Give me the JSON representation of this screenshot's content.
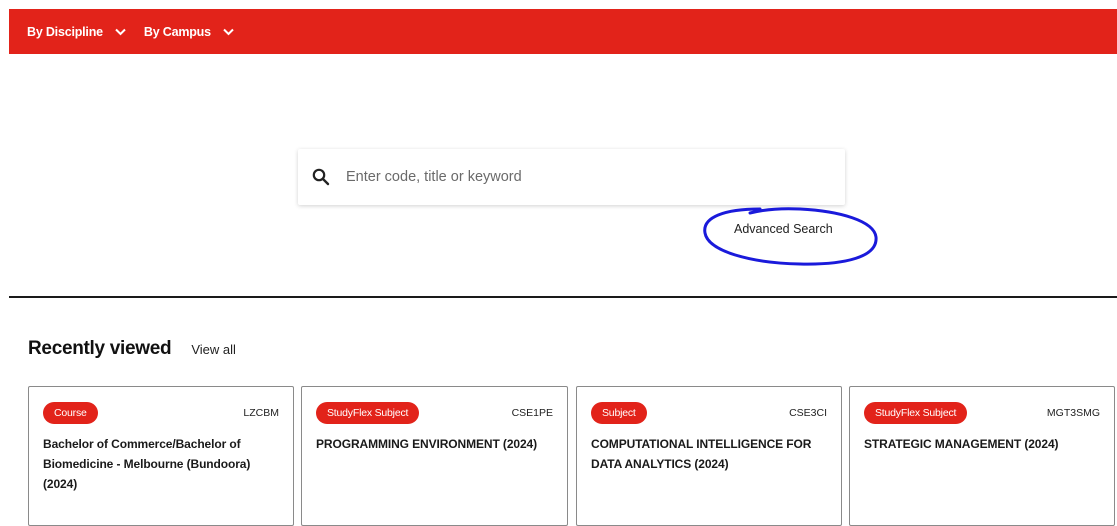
{
  "nav": {
    "items": [
      {
        "label": "By Discipline"
      },
      {
        "label": "By Campus"
      }
    ]
  },
  "search": {
    "placeholder": "Enter code, title or keyword",
    "value": "",
    "advanced_label": "Advanced Search"
  },
  "recent": {
    "title": "Recently viewed",
    "view_all_label": "View all",
    "cards": [
      {
        "badge": "Course",
        "code": "LZCBM",
        "title": "Bachelor of Commerce/Bachelor of Biomedicine - Melbourne (Bundoora) (2024)"
      },
      {
        "badge": "StudyFlex Subject",
        "code": "CSE1PE",
        "title": "PROGRAMMING ENVIRONMENT (2024)"
      },
      {
        "badge": "Subject",
        "code": "CSE3CI",
        "title": "COMPUTATIONAL INTELLIGENCE FOR DATA ANALYTICS (2024)"
      },
      {
        "badge": "StudyFlex Subject",
        "code": "MGT3SMG",
        "title": "STRATEGIC MANAGEMENT (2024)"
      }
    ]
  },
  "colors": {
    "brand_red": "#e2231a",
    "annotation_blue": "#1a1adb"
  }
}
